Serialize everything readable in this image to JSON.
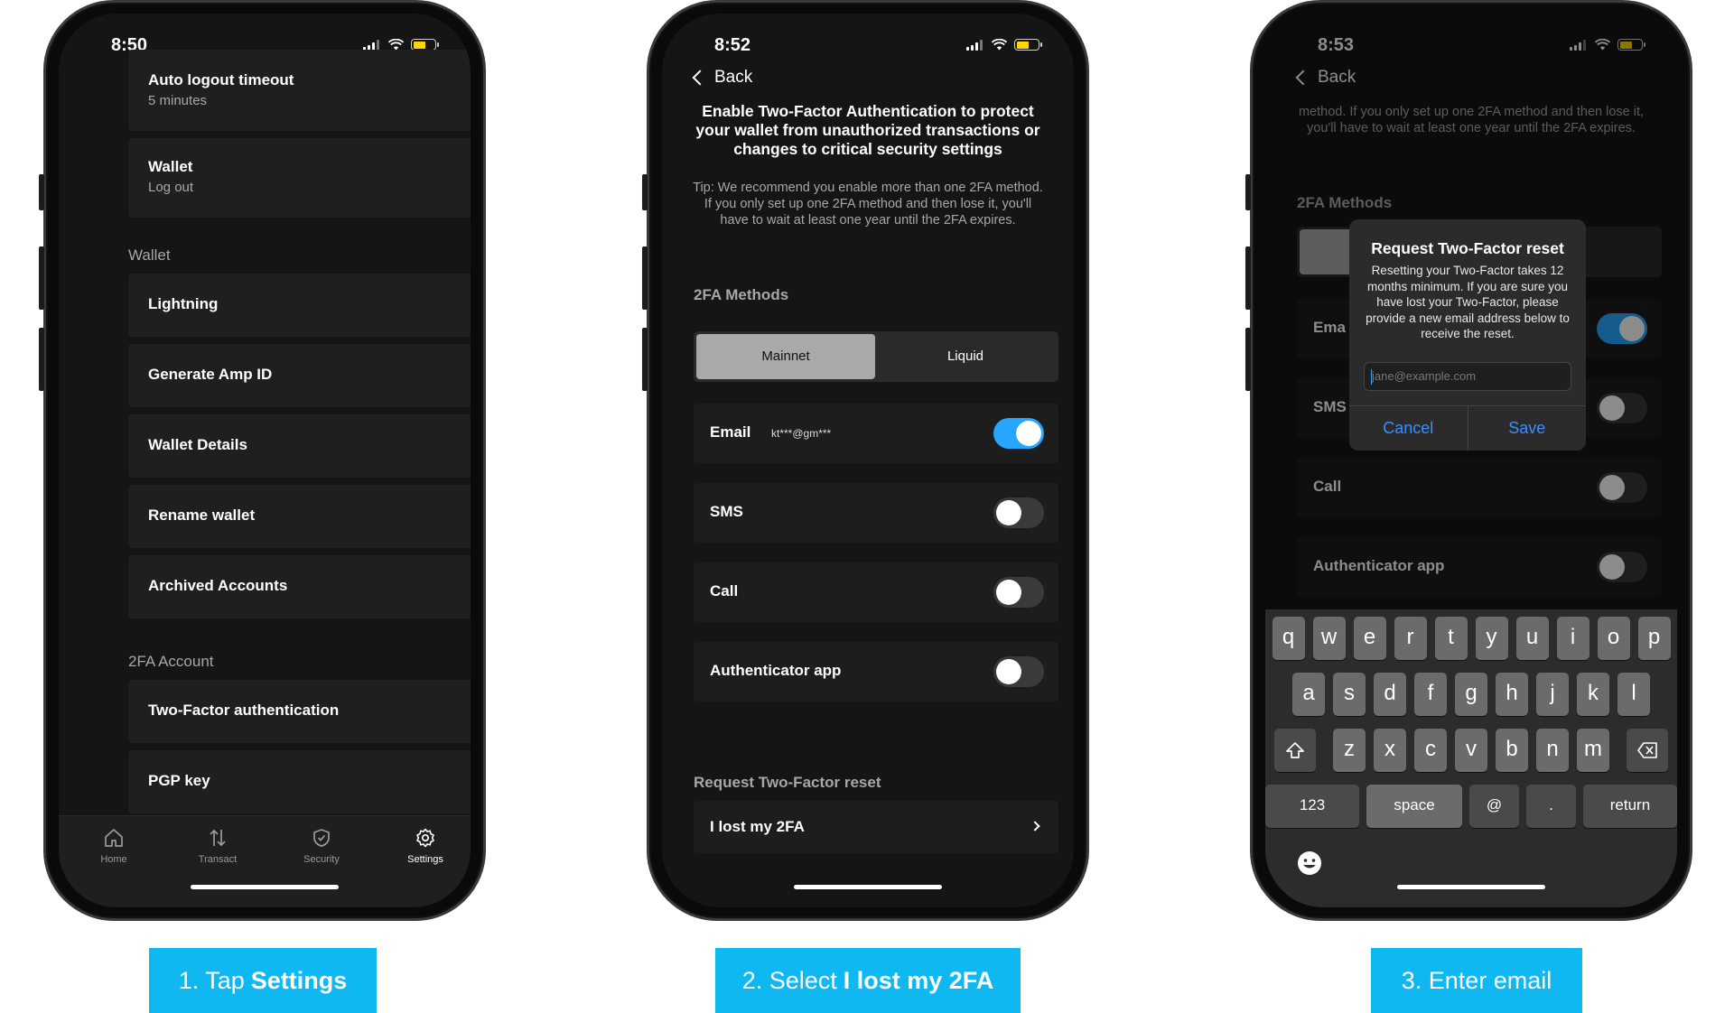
{
  "screen1": {
    "time": "8:50",
    "top_row": {
      "title": "Auto logout timeout",
      "sub": "5 minutes"
    },
    "wallet_row": {
      "title": "Wallet",
      "sub": "Log out"
    },
    "section_wallet": "Wallet",
    "wallet_items": [
      "Lightning",
      "Generate Amp ID",
      "Wallet Details",
      "Rename wallet",
      "Archived Accounts"
    ],
    "section_2fa": "2FA Account",
    "tfa_items": [
      "Two-Factor authentication",
      "PGP key"
    ],
    "tabs": [
      {
        "label": "Home",
        "icon": "home-icon"
      },
      {
        "label": "Transact",
        "icon": "transact-icon"
      },
      {
        "label": "Security",
        "icon": "shield-icon"
      },
      {
        "label": "Settings",
        "icon": "gear-icon"
      }
    ],
    "active_tab": "Settings"
  },
  "screen2": {
    "time": "8:52",
    "back": "Back",
    "heading": "Enable Two-Factor Authentication to protect your wallet from unauthorized transactions or changes to critical security settings",
    "tip": "Tip: We recommend you enable more than one 2FA method. If you only set up one 2FA method and then lose it, you'll have to wait at least one year until the 2FA expires.",
    "methods_title": "2FA Methods",
    "segments": [
      "Mainnet",
      "Liquid"
    ],
    "methods": [
      {
        "label": "Email",
        "detail": "kt***@gm***",
        "enabled": true
      },
      {
        "label": "SMS",
        "detail": "",
        "enabled": false
      },
      {
        "label": "Call",
        "detail": "",
        "enabled": false
      },
      {
        "label": "Authenticator app",
        "detail": "",
        "enabled": false
      }
    ],
    "reset_title": "Request Two-Factor reset",
    "lost_label": "I lost my 2FA"
  },
  "screen3": {
    "time": "8:53",
    "back": "Back",
    "tip_tail": "method. If you only set up one 2FA method and then lose it, you'll have to wait at least one year until the 2FA expires.",
    "methods_title": "2FA Methods",
    "bg_rows": [
      "Ema",
      "SMS",
      "Call",
      "Authenticator app"
    ],
    "dialog": {
      "title": "Request Two-Factor reset",
      "message": "Resetting your Two-Factor takes 12 months minimum. If you are sure you have lost your Two-Factor, please provide a new email address below to receive the reset.",
      "placeholder": "jane@example.com",
      "cancel": "Cancel",
      "save": "Save"
    },
    "keyboard": {
      "row1": [
        "q",
        "w",
        "e",
        "r",
        "t",
        "y",
        "u",
        "i",
        "o",
        "p"
      ],
      "row2": [
        "a",
        "s",
        "d",
        "f",
        "g",
        "h",
        "j",
        "k",
        "l"
      ],
      "row3": [
        "z",
        "x",
        "c",
        "v",
        "b",
        "n",
        "m"
      ],
      "k123": "123",
      "space": "space",
      "at": "@",
      "dot": ".",
      "ret": "return"
    }
  },
  "captions": [
    {
      "pre": "1. Tap",
      "bold": "Settings"
    },
    {
      "pre": "2. Select",
      "bold": "I lost my 2FA"
    },
    {
      "pre": "3. Enter email",
      "bold": ""
    }
  ],
  "colors": {
    "accent": "#10b8f2",
    "toggle_on": "#27a6ff",
    "link": "#3a8fff",
    "battery": "#ffd500"
  }
}
